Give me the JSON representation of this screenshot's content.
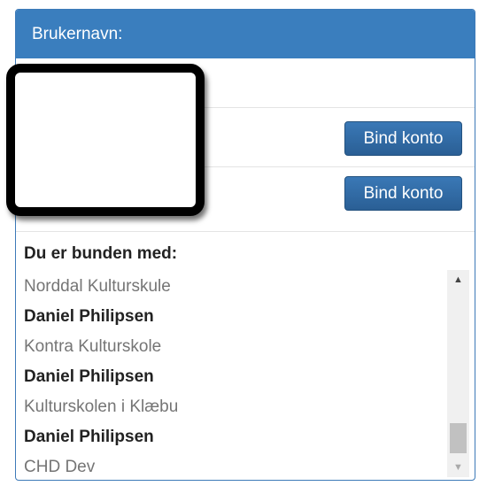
{
  "header": {
    "title": "Brukernavn:"
  },
  "accounts": [
    {
      "button_label": "Bind konto"
    },
    {
      "button_label": "Bind konto"
    }
  ],
  "bound": {
    "heading": "Du er bunden med:",
    "items": [
      {
        "text": "Norddal Kulturskule"
      },
      {
        "text": "Daniel Philipsen"
      },
      {
        "text": "Kontra Kulturskole"
      },
      {
        "text": "Daniel Philipsen"
      },
      {
        "text": "Kulturskolen i Klæbu"
      },
      {
        "text": "Daniel Philipsen"
      },
      {
        "text": "CHD Dev"
      }
    ]
  },
  "scrollbar": {
    "up_icon": "▲",
    "down_icon": "▼"
  }
}
